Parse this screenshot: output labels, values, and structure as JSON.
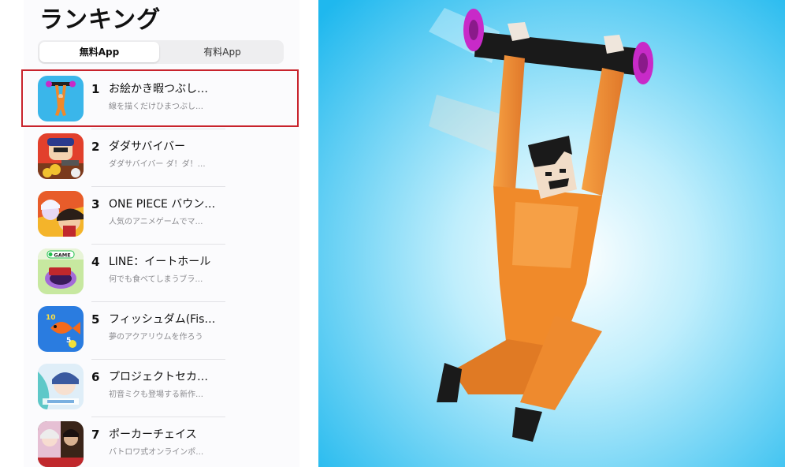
{
  "ranking": {
    "title": "ランキング",
    "tabs": {
      "free": "無料App",
      "paid": "有料App"
    },
    "items": [
      {
        "rank": "1",
        "name": "お絵かき暇つぶし…",
        "subtitle": "線を描くだけひまつぶし…",
        "icon": "hanging-man-app-icon"
      },
      {
        "rank": "2",
        "name": "ダダサバイバー",
        "subtitle": "ダダサバイバー ダ！ダ！…",
        "icon": "dada-survivor-app-icon"
      },
      {
        "rank": "3",
        "name": "ONE PIECE バウン…",
        "subtitle": "人気のアニメゲームでマ…",
        "icon": "one-piece-app-icon"
      },
      {
        "rank": "4",
        "name": "LINE：イートホール",
        "subtitle": "何でも食べてしまうブラ…",
        "icon": "eat-hole-app-icon",
        "badge": "GAME"
      },
      {
        "rank": "5",
        "name": "フィッシュダム(Fis…",
        "subtitle": "夢のアクアリウムを作ろう",
        "icon": "fishdom-app-icon",
        "badge_numbers": [
          "10",
          "5"
        ]
      },
      {
        "rank": "6",
        "name": "プロジェクトセカ…",
        "subtitle": "初音ミクも登場する新作…",
        "icon": "project-sekai-app-icon"
      },
      {
        "rank": "7",
        "name": "ポーカーチェイス",
        "subtitle": "バトロワ式オンラインポ…",
        "icon": "poker-chase-app-icon"
      }
    ]
  },
  "colors": {
    "highlight": "#c8232c",
    "art_background": "#2ec4f0",
    "jumpsuit": "#f0892a",
    "bar_wheel": "#d42ad0"
  }
}
